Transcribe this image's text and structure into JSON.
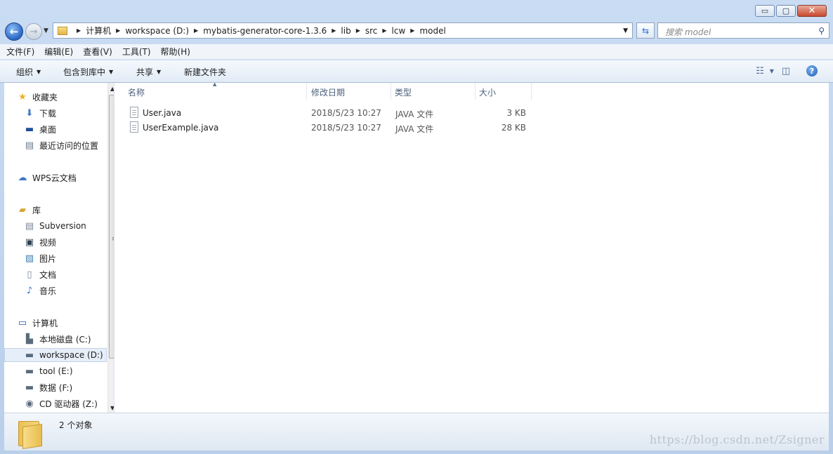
{
  "window": {
    "minimize": "▭",
    "maximize": "▢",
    "close": "✕"
  },
  "navigation": {
    "breadcrumb": [
      "计算机",
      "workspace (D:)",
      "mybatis-generator-core-1.3.6",
      "lib",
      "src",
      "lcw",
      "model"
    ],
    "search_placeholder": "搜索 model"
  },
  "menubar": [
    "文件(F)",
    "编辑(E)",
    "查看(V)",
    "工具(T)",
    "帮助(H)"
  ],
  "commandbar": {
    "organize": "组织",
    "include_in_library": "包含到库中",
    "share": "共享",
    "new_folder": "新建文件夹"
  },
  "sidebar": {
    "favorites": {
      "label": "收藏夹",
      "items": [
        "下载",
        "桌面",
        "最近访问的位置"
      ]
    },
    "wps": {
      "label": "WPS云文档"
    },
    "libraries": {
      "label": "库",
      "items": [
        "Subversion",
        "视频",
        "图片",
        "文档",
        "音乐"
      ]
    },
    "computer": {
      "label": "计算机",
      "items": [
        "本地磁盘 (C:)",
        "workspace (D:)",
        "tool (E:)",
        "数据 (F:)",
        "CD 驱动器 (Z:)"
      ]
    }
  },
  "columns": {
    "name": "名称",
    "date": "修改日期",
    "type": "类型",
    "size": "大小"
  },
  "files": [
    {
      "name": "User.java",
      "date": "2018/5/23 10:27",
      "type": "JAVA 文件",
      "size": "3 KB"
    },
    {
      "name": "UserExample.java",
      "date": "2018/5/23 10:27",
      "type": "JAVA 文件",
      "size": "28 KB"
    }
  ],
  "status": {
    "count": "2 个对象"
  },
  "watermark": "https://blog.csdn.net/Zsigner"
}
